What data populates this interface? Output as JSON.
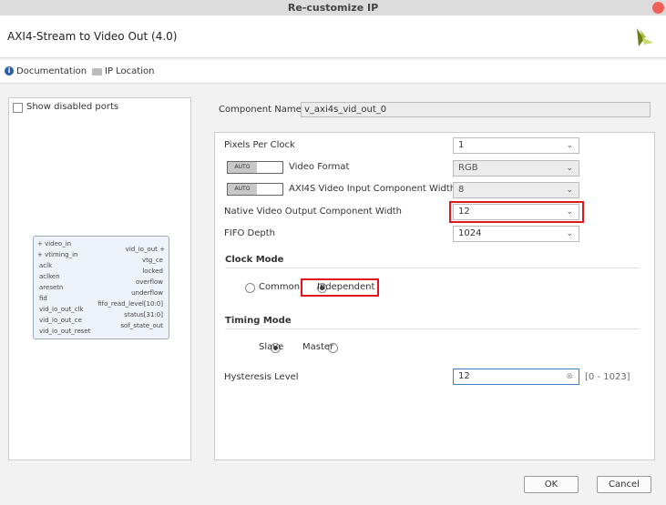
{
  "window": {
    "title": "Re-customize IP"
  },
  "header": {
    "ip_title": "AXI4-Stream to Video Out (4.0)"
  },
  "toolbar": {
    "documentation": "Documentation",
    "ip_location": "IP Location"
  },
  "left": {
    "show_disabled_ports": "Show disabled ports",
    "symbol": {
      "left_ports": [
        "video_in",
        "vtiming_in",
        "aclk",
        "aclken",
        "aresetn",
        "fid",
        "vid_io_out_clk",
        "vid_io_out_ce",
        "vid_io_out_reset"
      ],
      "right_ports": [
        "vid_io_out",
        "vtg_ce",
        "locked",
        "overflow",
        "underflow",
        "fifo_read_level[10:0]",
        "status[31:0]",
        "sof_state_out"
      ]
    }
  },
  "component": {
    "label": "Component Name",
    "value": "v_axi4s_vid_out_0"
  },
  "params": {
    "auto_label": "AUTO",
    "pixels_per_clock": {
      "label": "Pixels Per Clock",
      "value": "1"
    },
    "video_format": {
      "label": "Video Format",
      "value": "RGB"
    },
    "axi4s_width": {
      "label": "AXI4S Video Input Component Width",
      "value": "8"
    },
    "native_width": {
      "label": "Native Video Output Component Width",
      "value": "12"
    },
    "fifo_depth": {
      "label": "FIFO Depth",
      "value": "1024"
    }
  },
  "clock_mode": {
    "title": "Clock Mode",
    "common": "Common",
    "independent": "Independent",
    "selected": "Independent"
  },
  "timing_mode": {
    "title": "Timing Mode",
    "slave": "Slave",
    "master": "Master",
    "selected": "Slave"
  },
  "hysteresis": {
    "label": "Hysteresis Level",
    "value": "12",
    "range": "[0 - 1023]"
  },
  "footer": {
    "ok": "OK",
    "cancel": "Cancel"
  },
  "colors": {
    "highlight": "#e0161b",
    "info": "#2a5fa8"
  }
}
